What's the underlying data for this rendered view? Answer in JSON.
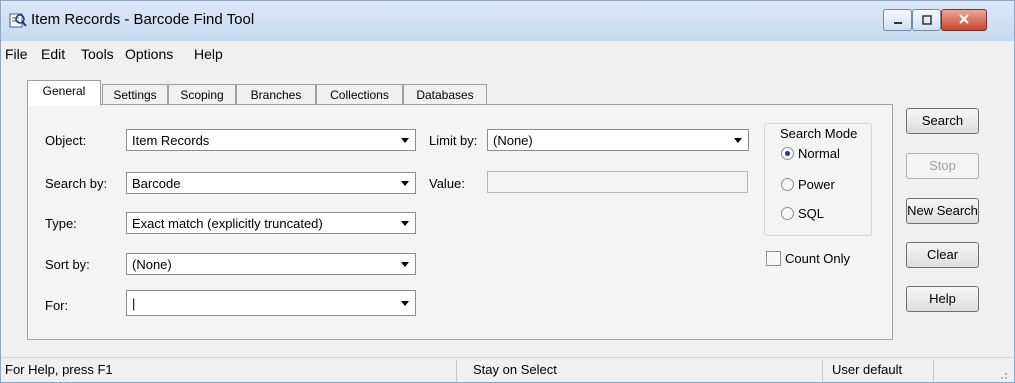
{
  "window": {
    "title": "Item Records - Barcode Find Tool",
    "icon": "search-records-icon",
    "controls": [
      "minimize-icon",
      "maximize-icon",
      "close-icon"
    ]
  },
  "menu": [
    "File",
    "Edit",
    "Tools",
    "Options",
    "Help"
  ],
  "tabs": [
    {
      "label": "General",
      "active": true
    },
    {
      "label": "Settings",
      "active": false
    },
    {
      "label": "Scoping",
      "active": false
    },
    {
      "label": "Branches",
      "active": false
    },
    {
      "label": "Collections",
      "active": false
    },
    {
      "label": "Databases",
      "active": false
    }
  ],
  "form": {
    "object": {
      "label": "Object:",
      "value": "Item Records"
    },
    "search_by": {
      "label": "Search by:",
      "value": "Barcode"
    },
    "type": {
      "label": "Type:",
      "value": "Exact match (explicitly truncated)"
    },
    "sort_by": {
      "label": "Sort by:",
      "value": "(None)"
    },
    "for": {
      "label": "For:",
      "value": "|"
    },
    "limit_by": {
      "label": "Limit by:",
      "value": "(None)"
    },
    "value": {
      "label": "Value:",
      "value": ""
    }
  },
  "search_mode": {
    "title": "Search Mode",
    "options": [
      {
        "label": "Normal",
        "selected": true
      },
      {
        "label": "Power",
        "selected": false
      },
      {
        "label": "SQL",
        "selected": false
      }
    ]
  },
  "count_only": {
    "label": "Count Only",
    "checked": false
  },
  "buttons": {
    "search": "Search",
    "stop": "Stop",
    "new_search": "New Search",
    "clear": "Clear",
    "help": "Help"
  },
  "status": {
    "help": "For Help, press F1",
    "mode": "Stay on Select",
    "profile": "User default"
  },
  "colors": {
    "radio_selected": "#1a3e8c",
    "close_button": "#c9452f",
    "title_bar": "#c6daf0"
  }
}
